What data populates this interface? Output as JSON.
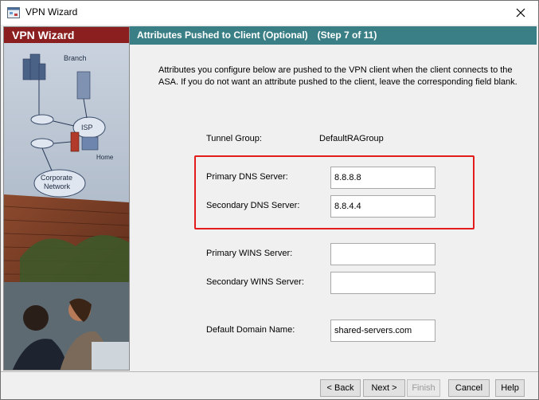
{
  "window": {
    "title": "VPN Wizard"
  },
  "left": {
    "header": "VPN Wizard",
    "art_labels": {
      "branch": "Branch",
      "isp": "ISP",
      "home": "Home",
      "corporate": "Corporate",
      "network": "Network"
    }
  },
  "header": {
    "title": "Attributes Pushed to Client (Optional)",
    "step": "(Step 7 of 11)"
  },
  "description": "Attributes you configure below are pushed to the VPN client when the client connects to the ASA. If you do not want an attribute pushed to the client, leave the corresponding field blank.",
  "form": {
    "tunnel_group_label": "Tunnel Group:",
    "tunnel_group_value": "DefaultRAGroup",
    "primary_dns_label": "Primary DNS Server:",
    "primary_dns_value": "8.8.8.8",
    "secondary_dns_label": "Secondary DNS Server:",
    "secondary_dns_value": "8.8.4.4",
    "primary_wins_label": "Primary WINS Server:",
    "primary_wins_value": "",
    "secondary_wins_label": "Secondary WINS Server:",
    "secondary_wins_value": "",
    "domain_label": "Default Domain Name:",
    "domain_value": "shared-servers.com"
  },
  "buttons": {
    "back": "< Back",
    "next": "Next >",
    "finish": "Finish",
    "cancel": "Cancel",
    "help": "Help"
  },
  "colors": {
    "left_header": "#8b1f1f",
    "right_header": "#3b7f86",
    "highlight": "#e21b1b"
  }
}
